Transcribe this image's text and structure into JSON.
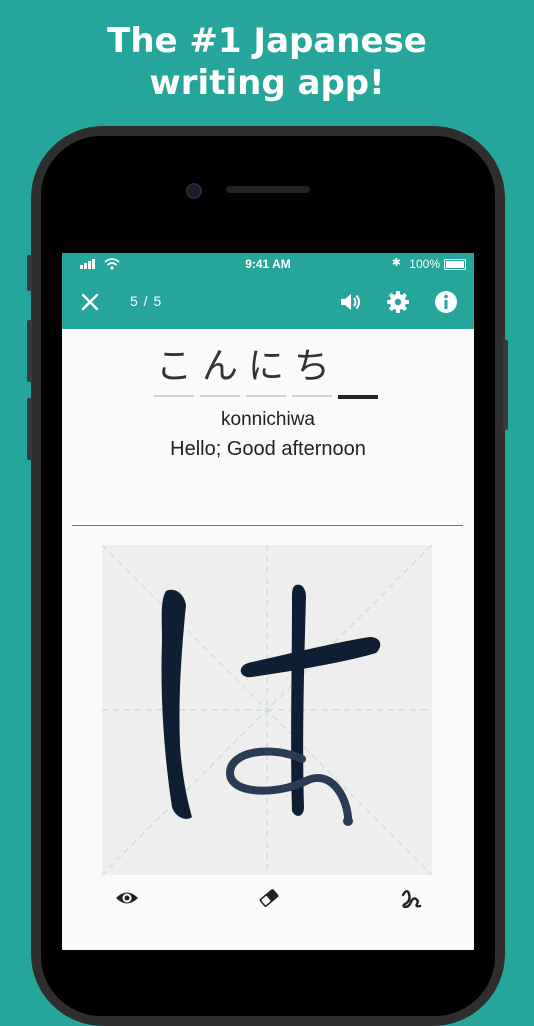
{
  "promo": {
    "headline_line1": "The #1 Japanese",
    "headline_line2": "writing app!"
  },
  "status_bar": {
    "time": "9:41 AM",
    "battery": "100%",
    "signal_icon": "signal-icon",
    "wifi_icon": "wifi-icon",
    "bluetooth_icon": "bluetooth-icon"
  },
  "toolbar": {
    "progress": "5 / 5",
    "close_icon": "close-icon",
    "sound_icon": "speaker-icon",
    "settings_icon": "gear-icon",
    "info_icon": "info-icon"
  },
  "word": {
    "kana": [
      "こ",
      "ん",
      "に",
      "ち",
      ""
    ],
    "active_index": 4,
    "romaji": "konnichiwa",
    "meaning": "Hello; Good afternoon"
  },
  "canvas": {
    "drawn_character": "は"
  },
  "bottom_bar": {
    "show_icon": "eye-icon",
    "eraser_icon": "eraser-icon",
    "stroke_icon": "stroke-icon"
  },
  "colors": {
    "accent": "#26a69a",
    "ink": "#0f1f33",
    "canvas_bg": "#eeeeee"
  }
}
